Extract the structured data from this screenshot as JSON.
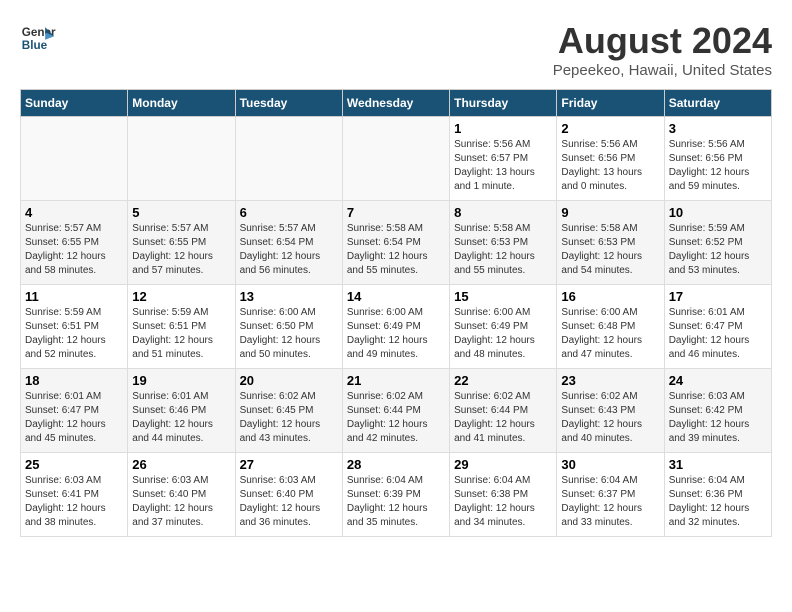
{
  "header": {
    "logo_line1": "General",
    "logo_line2": "Blue",
    "title": "August 2024",
    "subtitle": "Pepeekeo, Hawaii, United States"
  },
  "weekdays": [
    "Sunday",
    "Monday",
    "Tuesday",
    "Wednesday",
    "Thursday",
    "Friday",
    "Saturday"
  ],
  "weeks": [
    [
      {
        "day": "",
        "info": ""
      },
      {
        "day": "",
        "info": ""
      },
      {
        "day": "",
        "info": ""
      },
      {
        "day": "",
        "info": ""
      },
      {
        "day": "1",
        "info": "Sunrise: 5:56 AM\nSunset: 6:57 PM\nDaylight: 13 hours\nand 1 minute."
      },
      {
        "day": "2",
        "info": "Sunrise: 5:56 AM\nSunset: 6:56 PM\nDaylight: 13 hours\nand 0 minutes."
      },
      {
        "day": "3",
        "info": "Sunrise: 5:56 AM\nSunset: 6:56 PM\nDaylight: 12 hours\nand 59 minutes."
      }
    ],
    [
      {
        "day": "4",
        "info": "Sunrise: 5:57 AM\nSunset: 6:55 PM\nDaylight: 12 hours\nand 58 minutes."
      },
      {
        "day": "5",
        "info": "Sunrise: 5:57 AM\nSunset: 6:55 PM\nDaylight: 12 hours\nand 57 minutes."
      },
      {
        "day": "6",
        "info": "Sunrise: 5:57 AM\nSunset: 6:54 PM\nDaylight: 12 hours\nand 56 minutes."
      },
      {
        "day": "7",
        "info": "Sunrise: 5:58 AM\nSunset: 6:54 PM\nDaylight: 12 hours\nand 55 minutes."
      },
      {
        "day": "8",
        "info": "Sunrise: 5:58 AM\nSunset: 6:53 PM\nDaylight: 12 hours\nand 55 minutes."
      },
      {
        "day": "9",
        "info": "Sunrise: 5:58 AM\nSunset: 6:53 PM\nDaylight: 12 hours\nand 54 minutes."
      },
      {
        "day": "10",
        "info": "Sunrise: 5:59 AM\nSunset: 6:52 PM\nDaylight: 12 hours\nand 53 minutes."
      }
    ],
    [
      {
        "day": "11",
        "info": "Sunrise: 5:59 AM\nSunset: 6:51 PM\nDaylight: 12 hours\nand 52 minutes."
      },
      {
        "day": "12",
        "info": "Sunrise: 5:59 AM\nSunset: 6:51 PM\nDaylight: 12 hours\nand 51 minutes."
      },
      {
        "day": "13",
        "info": "Sunrise: 6:00 AM\nSunset: 6:50 PM\nDaylight: 12 hours\nand 50 minutes."
      },
      {
        "day": "14",
        "info": "Sunrise: 6:00 AM\nSunset: 6:49 PM\nDaylight: 12 hours\nand 49 minutes."
      },
      {
        "day": "15",
        "info": "Sunrise: 6:00 AM\nSunset: 6:49 PM\nDaylight: 12 hours\nand 48 minutes."
      },
      {
        "day": "16",
        "info": "Sunrise: 6:00 AM\nSunset: 6:48 PM\nDaylight: 12 hours\nand 47 minutes."
      },
      {
        "day": "17",
        "info": "Sunrise: 6:01 AM\nSunset: 6:47 PM\nDaylight: 12 hours\nand 46 minutes."
      }
    ],
    [
      {
        "day": "18",
        "info": "Sunrise: 6:01 AM\nSunset: 6:47 PM\nDaylight: 12 hours\nand 45 minutes."
      },
      {
        "day": "19",
        "info": "Sunrise: 6:01 AM\nSunset: 6:46 PM\nDaylight: 12 hours\nand 44 minutes."
      },
      {
        "day": "20",
        "info": "Sunrise: 6:02 AM\nSunset: 6:45 PM\nDaylight: 12 hours\nand 43 minutes."
      },
      {
        "day": "21",
        "info": "Sunrise: 6:02 AM\nSunset: 6:44 PM\nDaylight: 12 hours\nand 42 minutes."
      },
      {
        "day": "22",
        "info": "Sunrise: 6:02 AM\nSunset: 6:44 PM\nDaylight: 12 hours\nand 41 minutes."
      },
      {
        "day": "23",
        "info": "Sunrise: 6:02 AM\nSunset: 6:43 PM\nDaylight: 12 hours\nand 40 minutes."
      },
      {
        "day": "24",
        "info": "Sunrise: 6:03 AM\nSunset: 6:42 PM\nDaylight: 12 hours\nand 39 minutes."
      }
    ],
    [
      {
        "day": "25",
        "info": "Sunrise: 6:03 AM\nSunset: 6:41 PM\nDaylight: 12 hours\nand 38 minutes."
      },
      {
        "day": "26",
        "info": "Sunrise: 6:03 AM\nSunset: 6:40 PM\nDaylight: 12 hours\nand 37 minutes."
      },
      {
        "day": "27",
        "info": "Sunrise: 6:03 AM\nSunset: 6:40 PM\nDaylight: 12 hours\nand 36 minutes."
      },
      {
        "day": "28",
        "info": "Sunrise: 6:04 AM\nSunset: 6:39 PM\nDaylight: 12 hours\nand 35 minutes."
      },
      {
        "day": "29",
        "info": "Sunrise: 6:04 AM\nSunset: 6:38 PM\nDaylight: 12 hours\nand 34 minutes."
      },
      {
        "day": "30",
        "info": "Sunrise: 6:04 AM\nSunset: 6:37 PM\nDaylight: 12 hours\nand 33 minutes."
      },
      {
        "day": "31",
        "info": "Sunrise: 6:04 AM\nSunset: 6:36 PM\nDaylight: 12 hours\nand 32 minutes."
      }
    ]
  ]
}
